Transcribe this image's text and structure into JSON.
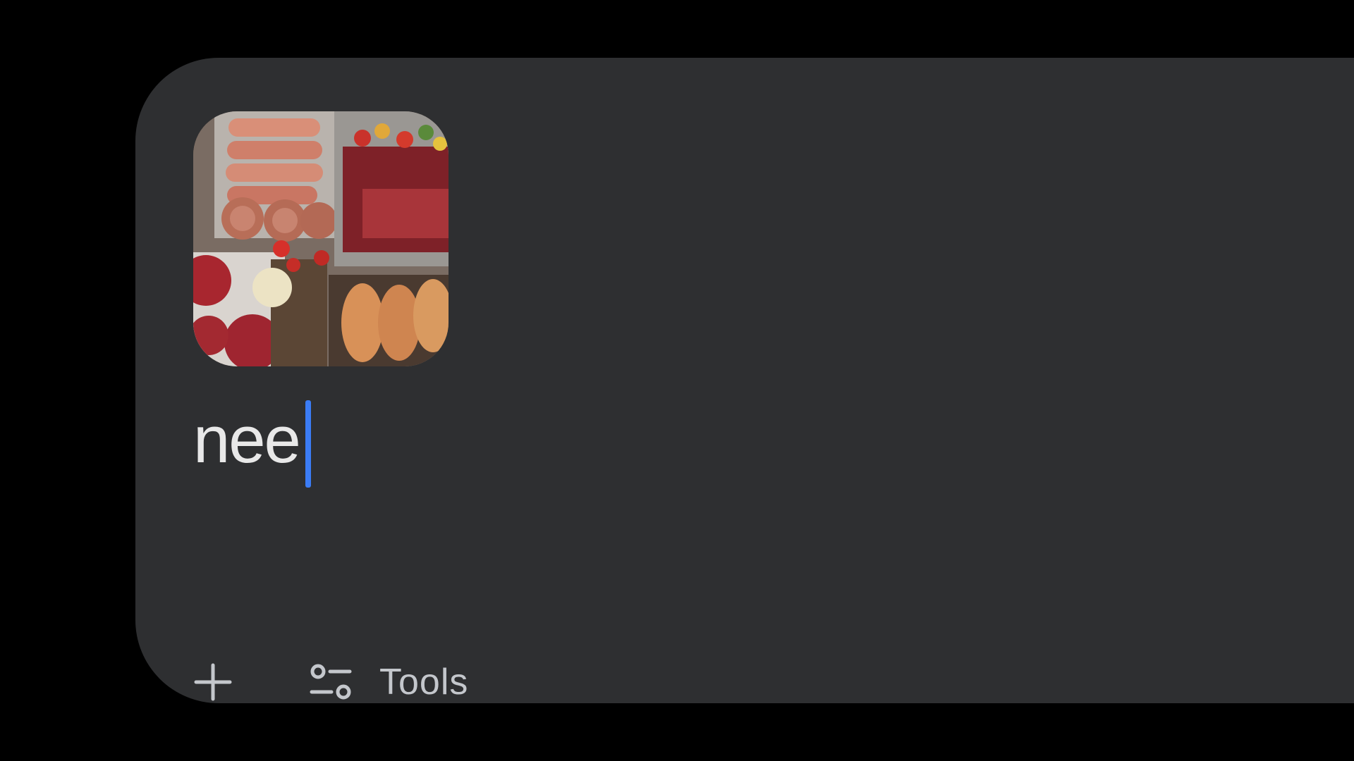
{
  "composer": {
    "attachment": {
      "kind": "image",
      "depicts": "raw-meat-platter"
    },
    "input": {
      "value": "nee"
    },
    "toolbar": {
      "add_icon": "plus-icon",
      "tools_icon": "tune-settings-icon",
      "tools_label": "Tools"
    }
  },
  "colors": {
    "background": "#000000",
    "panel": "#2e2f31",
    "text": "#e8e8e8",
    "muted": "#c4c7cc",
    "caret": "#3b7cf5"
  }
}
